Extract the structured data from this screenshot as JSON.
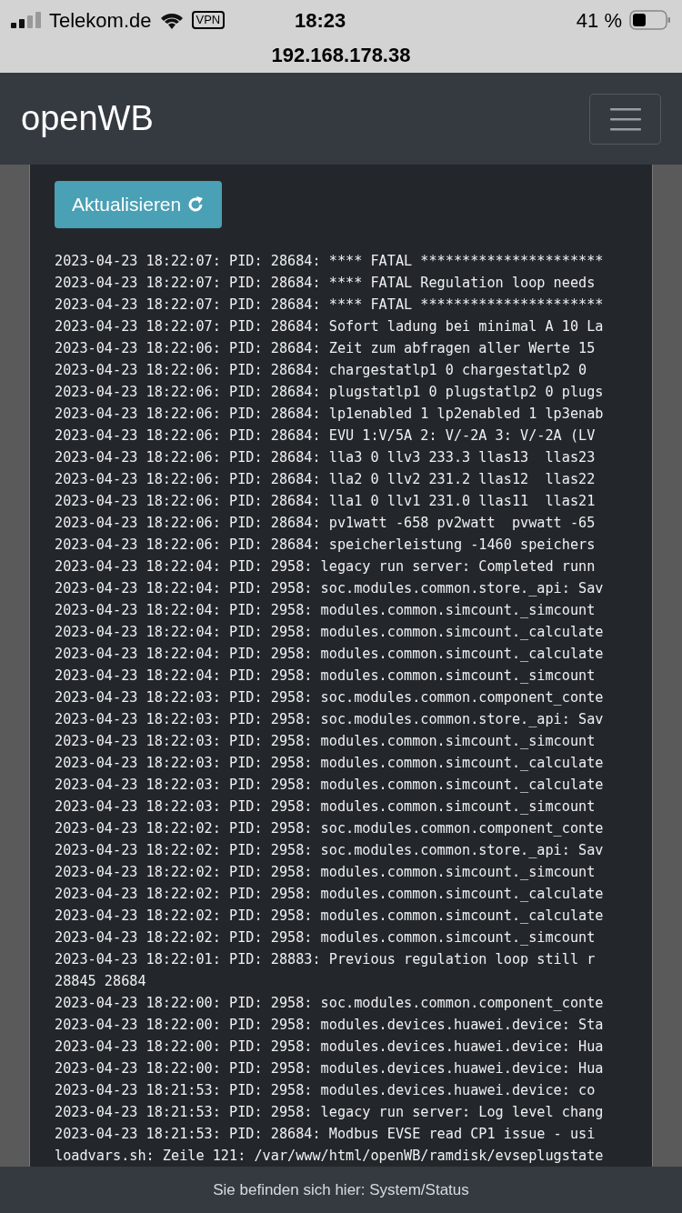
{
  "status_bar": {
    "carrier": "Telekom.de",
    "vpn": "VPN",
    "time": "18:23",
    "battery": "41 %"
  },
  "address_bar": {
    "url": "192.168.178.38"
  },
  "navbar": {
    "brand": "openWB"
  },
  "refresh_button": {
    "label": "Aktualisieren"
  },
  "log_lines": [
    "2023-04-23 18:22:07: PID: 28684: **** FATAL **********************",
    "2023-04-23 18:22:07: PID: 28684: **** FATAL Regulation loop needs",
    "2023-04-23 18:22:07: PID: 28684: **** FATAL **********************",
    "2023-04-23 18:22:07: PID: 28684: Sofort ladung bei minimal A 10 La",
    "2023-04-23 18:22:06: PID: 28684: Zeit zum abfragen aller Werte 15",
    "2023-04-23 18:22:06: PID: 28684: chargestatlp1 0 chargestatlp2 0",
    "2023-04-23 18:22:06: PID: 28684: plugstatlp1 0 plugstatlp2 0 plugs",
    "2023-04-23 18:22:06: PID: 28684: lp1enabled 1 lp2enabled 1 lp3enab",
    "2023-04-23 18:22:06: PID: 28684: EVU 1:V/5A 2: V/-2A 3: V/-2A (LV",
    "2023-04-23 18:22:06: PID: 28684: lla3 0 llv3 233.3 llas13  llas23",
    "2023-04-23 18:22:06: PID: 28684: lla2 0 llv2 231.2 llas12  llas22",
    "2023-04-23 18:22:06: PID: 28684: lla1 0 llv1 231.0 llas11  llas21",
    "2023-04-23 18:22:06: PID: 28684: pv1watt -658 pv2watt  pvwatt -65",
    "2023-04-23 18:22:06: PID: 28684: speicherleistung -1460 speichers",
    "2023-04-23 18:22:04: PID: 2958: legacy run server: Completed runn",
    "2023-04-23 18:22:04: PID: 2958: soc.modules.common.store._api: Sav",
    "2023-04-23 18:22:04: PID: 2958: modules.common.simcount._simcount",
    "2023-04-23 18:22:04: PID: 2958: modules.common.simcount._calculate",
    "2023-04-23 18:22:04: PID: 2958: modules.common.simcount._calculate",
    "2023-04-23 18:22:04: PID: 2958: modules.common.simcount._simcount",
    "2023-04-23 18:22:03: PID: 2958: soc.modules.common.component_conte",
    "2023-04-23 18:22:03: PID: 2958: soc.modules.common.store._api: Sav",
    "2023-04-23 18:22:03: PID: 2958: modules.common.simcount._simcount",
    "2023-04-23 18:22:03: PID: 2958: modules.common.simcount._calculate",
    "2023-04-23 18:22:03: PID: 2958: modules.common.simcount._calculate",
    "2023-04-23 18:22:03: PID: 2958: modules.common.simcount._simcount",
    "2023-04-23 18:22:02: PID: 2958: soc.modules.common.component_conte",
    "2023-04-23 18:22:02: PID: 2958: soc.modules.common.store._api: Sav",
    "2023-04-23 18:22:02: PID: 2958: modules.common.simcount._simcount",
    "2023-04-23 18:22:02: PID: 2958: modules.common.simcount._calculate",
    "2023-04-23 18:22:02: PID: 2958: modules.common.simcount._calculate",
    "2023-04-23 18:22:02: PID: 2958: modules.common.simcount._simcount",
    "2023-04-23 18:22:01: PID: 28883: Previous regulation loop still r",
    "28845 28684",
    "2023-04-23 18:22:00: PID: 2958: soc.modules.common.component_conte",
    "2023-04-23 18:22:00: PID: 2958: modules.devices.huawei.device: Sta",
    "2023-04-23 18:22:00: PID: 2958: modules.devices.huawei.device: Hua",
    "2023-04-23 18:22:00: PID: 2958: modules.devices.huawei.device: Hua",
    "2023-04-23 18:21:53: PID: 2958: modules.devices.huawei.device: co",
    "2023-04-23 18:21:53: PID: 2958: legacy run server: Log level chang",
    "2023-04-23 18:21:53: PID: 28684: Modbus EVSE read CP1 issue - usi",
    "loadvars.sh: Zeile 121: /var/www/html/openWB/ramdisk/evseplugstate"
  ],
  "footer": {
    "text": "Sie befinden sich hier: System/Status"
  }
}
